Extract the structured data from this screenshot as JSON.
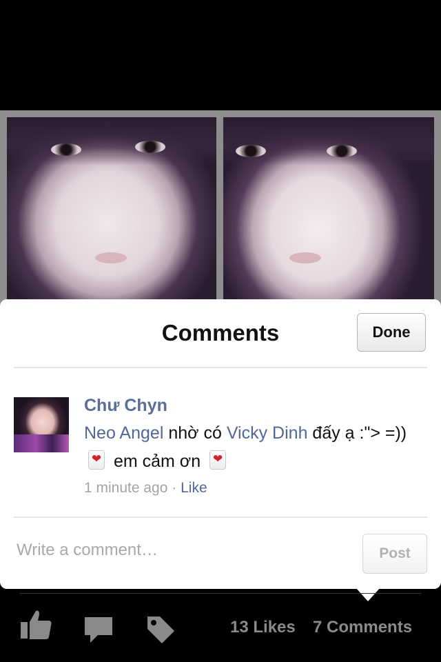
{
  "sheet": {
    "title": "Comments",
    "done_label": "Done"
  },
  "comment": {
    "author": "Chư Chyn",
    "mention_1": "Neo Angel",
    "text_1": " nhờ có ",
    "mention_2": "Vicky Dinh",
    "text_2": " đấy ạ :\"> =))",
    "text_3": "em cảm ơn",
    "heart_glyph": "❤",
    "time": "1 minute ago",
    "separator": " · ",
    "like_label": "Like"
  },
  "composer": {
    "placeholder": "Write a comment…",
    "post_label": "Post"
  },
  "footer": {
    "likes": "13 Likes",
    "comments": "7 Comments"
  },
  "colors": {
    "link": "#4f6898",
    "author": "#5a6e96",
    "background": "#000000"
  }
}
